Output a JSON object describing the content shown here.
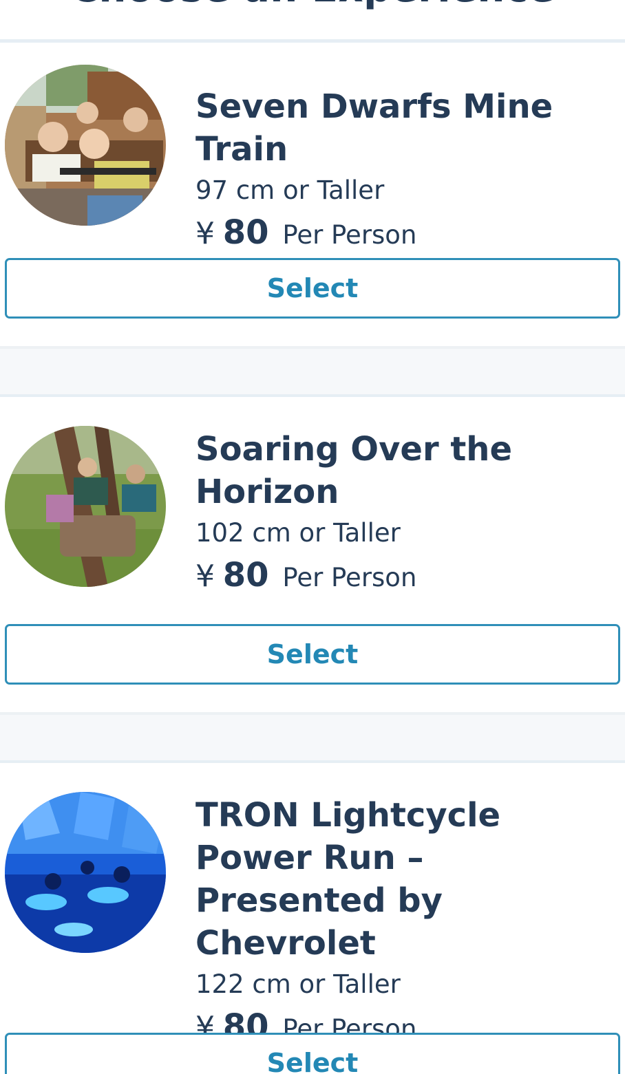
{
  "header": {
    "title": "Choose an Experience"
  },
  "colors": {
    "accent": "#2f8fb8",
    "text": "#253b56"
  },
  "experiences": [
    {
      "name": "Seven Dwarfs Mine Train",
      "height": "97 cm or Taller",
      "currency": "¥",
      "price": "80",
      "price_unit": "Per Person",
      "image_icon": "mine-train-photo",
      "select_label": "Select"
    },
    {
      "name": "Soaring Over the Horizon",
      "height": "102 cm or Taller",
      "currency": "¥",
      "price": "80",
      "price_unit": "Per Person",
      "image_icon": "soaring-photo",
      "select_label": "Select"
    },
    {
      "name": "TRON Lightcycle Power Run – Presented by Chevrolet",
      "height": "122 cm or Taller",
      "currency": "¥",
      "price": "80",
      "price_unit": "Per Person",
      "image_icon": "tron-photo",
      "select_label": "Select"
    }
  ]
}
